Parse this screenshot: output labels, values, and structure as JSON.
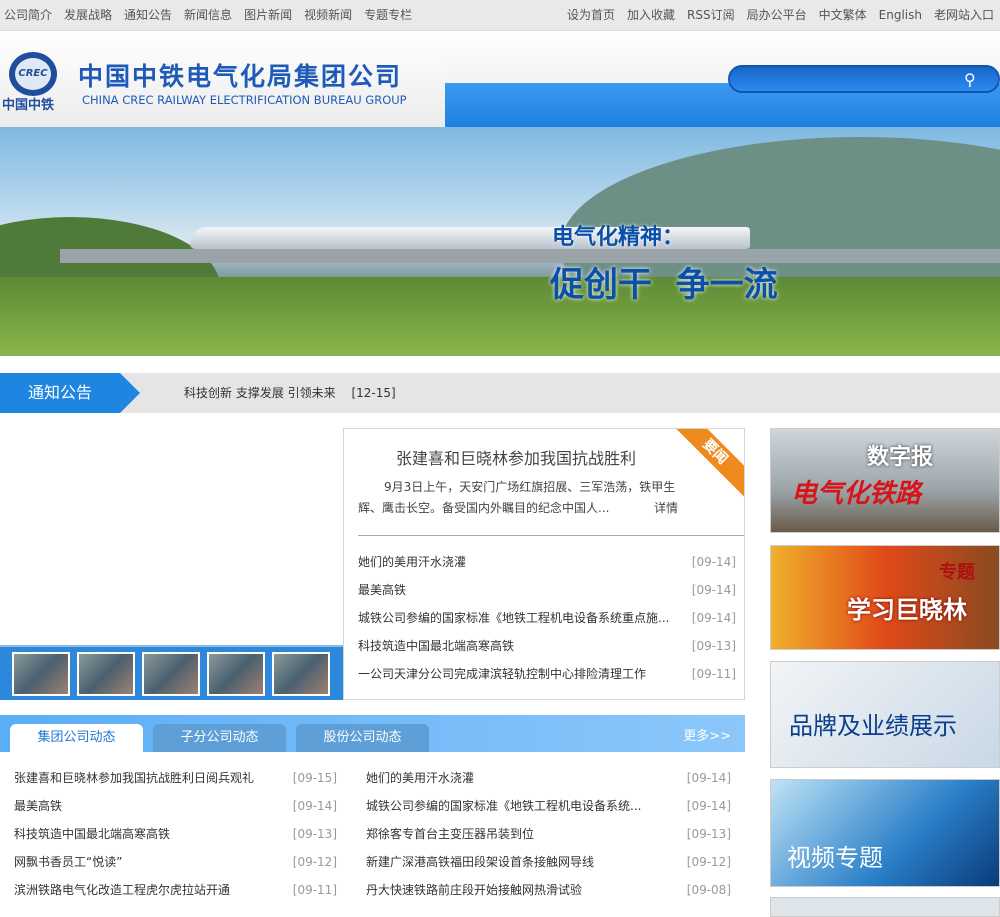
{
  "topnav_left": [
    "公司简介",
    "发展战略",
    "通知公告",
    "新闻信息",
    "图片新闻",
    "视频新闻",
    "专题专栏"
  ],
  "topnav_right": [
    "设为首页",
    "加入收藏",
    "RSS订阅",
    "局办公平台",
    "中文繁体",
    "English",
    "老网站入口"
  ],
  "logo": {
    "emblem": "CREC",
    "emblem_cn": "中国中铁",
    "name_cn": "中国中铁电气化局集团公司",
    "name_en": "CHINA CREC RAILWAY ELECTRIFICATION BUREAU GROUP"
  },
  "search": {
    "placeholder": ""
  },
  "banner": {
    "line1": "电气化精神：",
    "line2": "促创干  争一流"
  },
  "notice": {
    "label": "通知公告",
    "text": "科技创新 支撑发展 引领未来",
    "date": "[12-15]"
  },
  "featured": {
    "ribbon": "要闻",
    "title": "张建喜和巨晓林参加我国抗战胜利",
    "summary": "9月3日上午，天安门广场红旗招展、三军浩荡，铁甲生辉、鹰击长空。备受国内外瞩目的纪念中国人...",
    "more": "详情",
    "list": [
      {
        "t": "她们的美用汗水浇灌",
        "d": "[09-14]"
      },
      {
        "t": "最美高铁",
        "d": "[09-14]"
      },
      {
        "t": "城铁公司参编的国家标准《地铁工程机电设备系统重点施...",
        "d": "[09-14]"
      },
      {
        "t": "科技筑造中国最北端高寒高铁",
        "d": "[09-13]"
      },
      {
        "t": "一公司天津分公司完成津滨轻轨控制中心排险清理工作",
        "d": "[09-11]"
      }
    ]
  },
  "tabs": [
    "集团公司动态",
    "子分公司动态",
    "股份公司动态"
  ],
  "more": "更多>>",
  "news_left": [
    {
      "t": "张建喜和巨晓林参加我国抗战胜利日阅兵观礼",
      "d": "[09-15]"
    },
    {
      "t": "最美高铁",
      "d": "[09-14]"
    },
    {
      "t": "科技筑造中国最北端高寒高铁",
      "d": "[09-13]"
    },
    {
      "t": "网飘书香员工“悦读”",
      "d": "[09-12]"
    },
    {
      "t": "滨洲铁路电气化改造工程虎尔虎拉站开通",
      "d": "[09-11]"
    }
  ],
  "news_right": [
    {
      "t": "她们的美用汗水浇灌",
      "d": "[09-14]"
    },
    {
      "t": "城铁公司参编的国家标准《地铁工程机电设备系统...",
      "d": "[09-14]"
    },
    {
      "t": "郑徐客专首台主变压器吊装到位",
      "d": "[09-13]"
    },
    {
      "t": "新建广深港高铁福田段架设首条接触网导线",
      "d": "[09-12]"
    },
    {
      "t": "丹大快速铁路前庄段开始接触网热滑试验",
      "d": "[09-08]"
    }
  ],
  "tiles": [
    {
      "a": "数字报",
      "b": "电气化铁路"
    },
    {
      "a": "专题",
      "b": "学习巨晓林"
    },
    {
      "a": "品牌及业绩展示"
    },
    {
      "a": "视频专题"
    }
  ]
}
